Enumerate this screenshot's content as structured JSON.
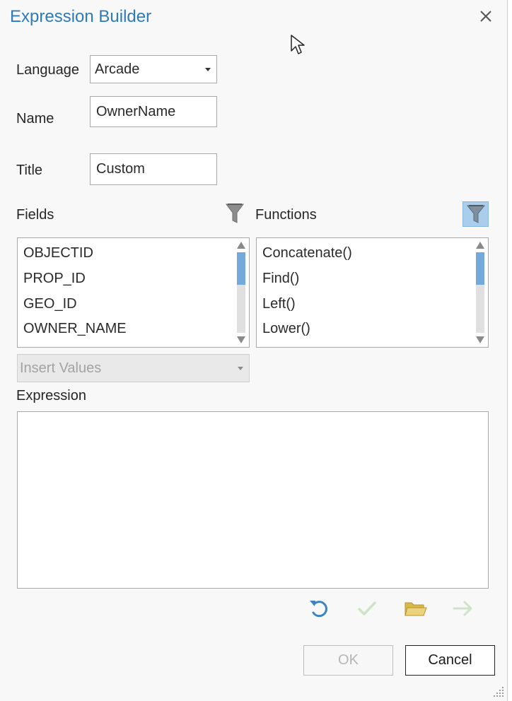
{
  "dialog": {
    "title": "Expression Builder"
  },
  "form": {
    "language_label": "Language",
    "language_value": "Arcade",
    "name_label": "Name",
    "name_value": "OwnerName",
    "title_label": "Title",
    "title_value": "Custom"
  },
  "fields": {
    "label": "Fields",
    "items": [
      "OBJECTID",
      "PROP_ID",
      "GEO_ID",
      "OWNER_NAME"
    ]
  },
  "functions": {
    "label": "Functions",
    "items": [
      "Concatenate()",
      "Find()",
      "Left()",
      "Lower()"
    ]
  },
  "insert_values": {
    "placeholder": "Insert Values"
  },
  "expression": {
    "label": "Expression",
    "value": ""
  },
  "buttons": {
    "ok": "OK",
    "cancel": "Cancel"
  },
  "icons": {
    "close": "close-icon",
    "fields_filter": "filter-icon",
    "functions_filter": "filter-icon",
    "undo": "undo-icon",
    "verify": "check-icon",
    "open": "folder-open-icon",
    "run": "arrow-right-icon",
    "resize": "resize-grip-icon"
  },
  "colors": {
    "title": "#2f7ab8",
    "accent": "#74a9db",
    "filter_active": "#a9cdeb",
    "folder": "#e2c65a"
  }
}
